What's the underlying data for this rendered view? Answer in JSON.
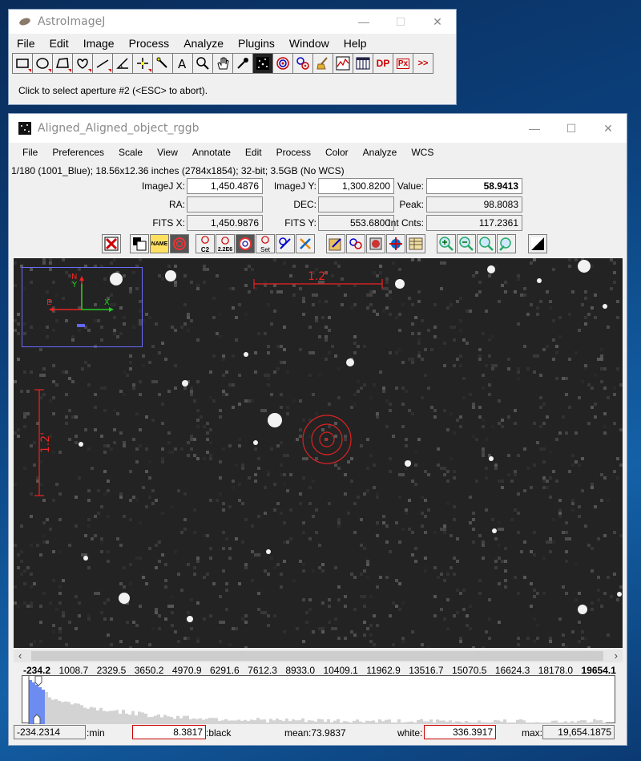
{
  "main_window": {
    "title": "AstroImageJ",
    "menu": [
      "File",
      "Edit",
      "Image",
      "Process",
      "Analyze",
      "Plugins",
      "Window",
      "Help"
    ],
    "toolbar_icons": [
      "rectangle-tool-icon",
      "oval-tool-icon",
      "polygon-tool-icon",
      "freehand-tool-icon",
      "line-tool-icon",
      "angle-tool-icon",
      "point-tool-icon",
      "wand-tool-icon",
      "text-tool-icon",
      "magnifier-tool-icon",
      "hand-tool-icon",
      "dropper-tool-icon",
      "astro-tool-icon",
      "aperture-tool-icon",
      "multi-aperture-icon",
      "clear-overlay-icon",
      "plot-icon",
      "table-icon",
      "dp-icon",
      "px-icon",
      "more-tools-icon"
    ],
    "dp_label": "DP",
    "px_label": "Px",
    "more_label": ">>",
    "status": "Click to select aperture #2 (<ESC> to abort)."
  },
  "image_window": {
    "title": "Aligned_Aligned_object_rggb",
    "menu": [
      "File",
      "Preferences",
      "Scale",
      "View",
      "Annotate",
      "Edit",
      "Process",
      "Color",
      "Analyze",
      "WCS"
    ],
    "info": "1/180 (1001_Blue); 18.56x12.36 inches (2784x1854); 32-bit; 3.5GB (No WCS)",
    "fields": {
      "imagej_x_label": "ImageJ X:",
      "imagej_x": "1,450.4876",
      "imagej_y_label": "ImageJ Y:",
      "imagej_y": "1,300.8200",
      "value_label": "Value:",
      "value": "58.9413",
      "ra_label": "RA:",
      "ra": "",
      "dec_label": "DEC:",
      "dec": "",
      "peak_label": "Peak:",
      "peak": "98.8083",
      "fits_x_label": "FITS X:",
      "fits_x": "1,450.9876",
      "fits_y_label": "FITS Y:",
      "fits_y": "553.6800",
      "int_cnts_label": "Int Cnts:",
      "int_cnts": "117.2361"
    },
    "button_labels": {
      "name": "NAME",
      "c2": "C2",
      "two26": "2.2E6",
      "set": "Set"
    },
    "scale_label": "1.2'",
    "compass": {
      "n": "N",
      "y": "Y",
      "e": "E",
      "x": "X"
    },
    "histogram_ticks": [
      "-234.2",
      "1008.7",
      "2329.5",
      "3650.2",
      "4970.9",
      "6291.6",
      "7612.3",
      "8933.0",
      "10409.1",
      "11962.9",
      "13516.7",
      "15070.5",
      "16624.3",
      "18178.0",
      "19654.1"
    ],
    "min_value": "-234.2314",
    "min_label": ":min",
    "black_value": "8.3817",
    "black_label": ":black",
    "mean_text": "mean:73.9837",
    "white_label": "white:",
    "white_value": "336.3917",
    "max_label": "max:",
    "max_value": "19,654.1875"
  }
}
